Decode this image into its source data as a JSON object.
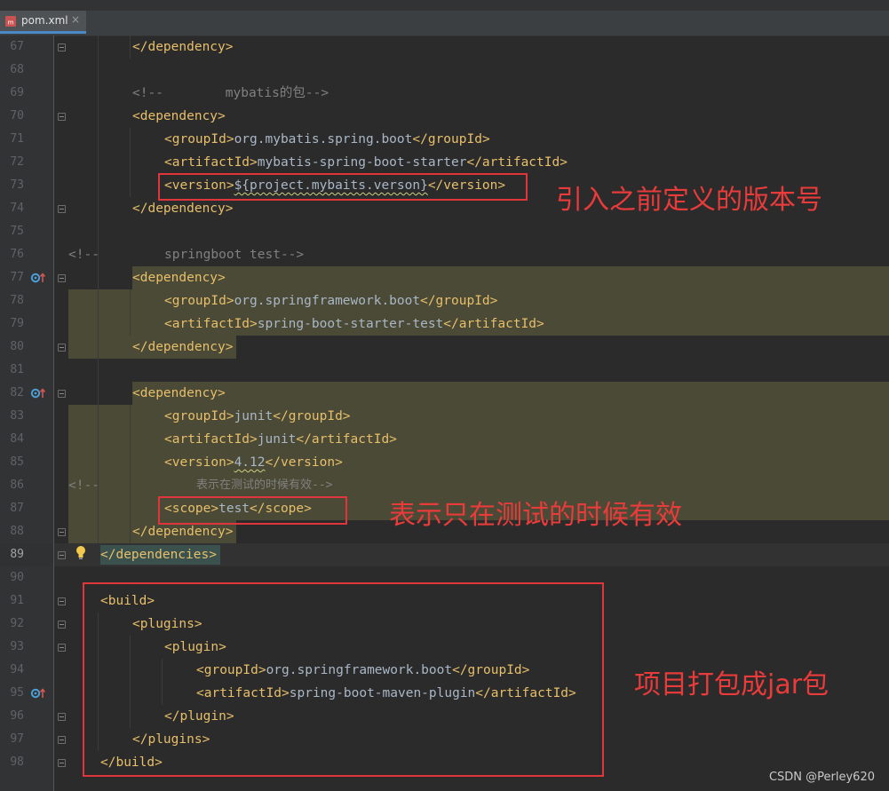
{
  "tab": {
    "label": "pom.xml",
    "close": "×"
  },
  "line_numbers": [
    "67",
    "68",
    "69",
    "70",
    "71",
    "72",
    "73",
    "74",
    "75",
    "76",
    "77",
    "78",
    "79",
    "80",
    "81",
    "82",
    "83",
    "84",
    "85",
    "86",
    "87",
    "88",
    "89",
    "90",
    "91",
    "92",
    "93",
    "94",
    "95",
    "96",
    "97",
    "98"
  ],
  "code": {
    "l67_close": "</dependency>",
    "l69_comment": "<!--        mybatis的包-->",
    "l70_open": "<dependency>",
    "l71_open": "<groupId>",
    "l71_val": "org.mybatis.spring.boot",
    "l71_close": "</groupId>",
    "l72_open": "<artifactId>",
    "l72_val": "mybatis-spring-boot-starter",
    "l72_close": "</artifactId>",
    "l73_open": "<version>",
    "l73_val": "${project.mybaits.verson}",
    "l73_close": "</version>",
    "l74_close": "</dependency>",
    "l76_comment_a": "<!--",
    "l76_comment_b": "springboot test-->",
    "l77_open": "<dependency>",
    "l78_open": "<groupId>",
    "l78_val": "org.springframework.boot",
    "l78_close": "</groupId>",
    "l79_open": "<artifactId>",
    "l79_val": "spring-boot-starter-test",
    "l79_close": "</artifactId>",
    "l80_close": "</dependency>",
    "l82_open": "<dependency>",
    "l83_open": "<groupId>",
    "l83_val": "junit",
    "l83_close": "</groupId>",
    "l84_open": "<artifactId>",
    "l84_val": "junit",
    "l84_close": "</artifactId>",
    "l85_open": "<version>",
    "l85_val": "4.12",
    "l85_close": "</version>",
    "l86_comment_a": "<!--",
    "l86_comment_b": "表示在测试的时候有效-->",
    "l87_open": "<scope>",
    "l87_val": "test",
    "l87_close": "</scope>",
    "l88_close": "</dependency>",
    "l89_close": "</dependencies>",
    "l91_open": "<build>",
    "l92_open": "<plugins>",
    "l93_open": "<plugin>",
    "l94_open": "<groupId>",
    "l94_val": "org.springframework.boot",
    "l94_close": "</groupId>",
    "l95_open": "<artifactId>",
    "l95_val": "spring-boot-maven-plugin",
    "l95_close": "</artifactId>",
    "l96_close": "</plugin>",
    "l97_close": "</plugins>",
    "l98_close": "</build>"
  },
  "annotations": {
    "version_note": "引入之前定义的版本号",
    "scope_note": "表示只在测试的时候有效",
    "build_note": "项目打包成jar包"
  },
  "watermark": "CSDN @Perley620",
  "colors": {
    "tag": "#e8bf6a",
    "text": "#a9b7c6",
    "comment": "#808080",
    "annotation": "#e0353b",
    "highlight": "#4a4a36"
  }
}
